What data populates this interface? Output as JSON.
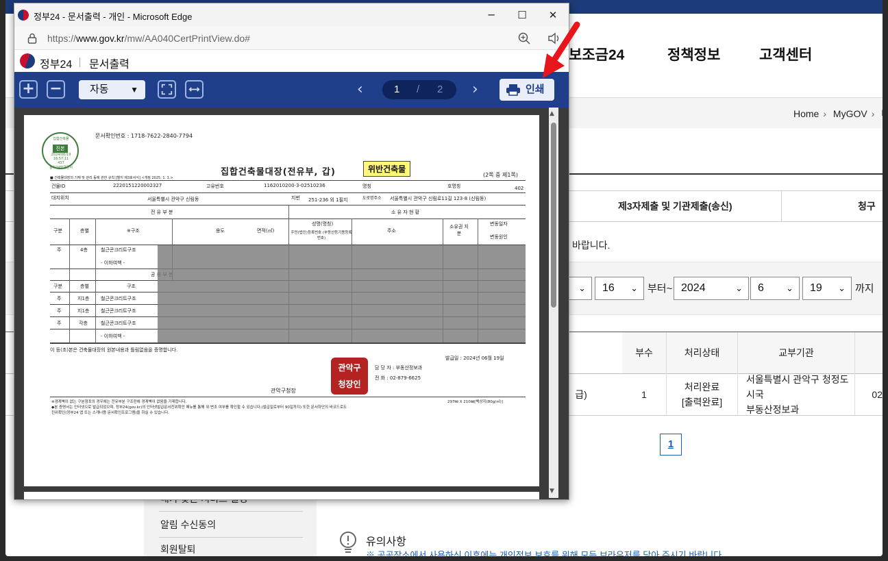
{
  "background_page": {
    "nav": [
      "보조금24",
      "정책정보",
      "고객센터"
    ],
    "breadcrumb": [
      "Home",
      "MyGOV",
      "나"
    ],
    "tabs": [
      "제3자제출 및 기관제출(송신)",
      "청구"
    ],
    "notice_fragment": "l 바랍니다.",
    "date_filter": {
      "start_day": "16",
      "from_label": "부터~",
      "end_year": "2024",
      "end_month": "6",
      "end_day": "19",
      "until_label": "까지"
    },
    "table": {
      "headers": [
        "부수",
        "처리상태",
        "교부기관"
      ],
      "row": {
        "first_cell_fragment": "급)",
        "copies": "1",
        "status_line1": "처리완료",
        "status_line2": "[출력완료]",
        "agency_line1": "서울특별시 관악구 청정도시국",
        "agency_line2": "부동산정보과",
        "last_cell_fragment": "02"
      }
    },
    "pagination": [
      "1"
    ],
    "sidebar": {
      "items": [
        "내가 찾은 서비스 설정",
        "알림 수신동의",
        "회원탈퇴"
      ]
    },
    "caution": {
      "title": "유의사항",
      "text": "※ 공공장소에서 사용하신 이후에는 개인정보 보호를 위해 모든 브라우저를 닫아 주시기 바랍니다."
    }
  },
  "popup": {
    "window_title": "정부24 - 문서출력 - 개인 - Microsoft Edge",
    "url_prefix": "https://",
    "url_host": "www.gov.kr",
    "url_path": "/mw/AA040CertPrintView.do#",
    "site_name": "정부24",
    "site_section": "문서출력",
    "viewer": {
      "zoom_mode": "자동",
      "current_page": "1",
      "page_separator": "/",
      "total_pages": "2",
      "print_label": "인쇄"
    },
    "document": {
      "doc_number": "문서확인번호 : 1718-7622-2840-7794",
      "title": "집합건축물대장(전유부, 갑)",
      "violation_badge": "위반건축물",
      "page_info": "(2쪽 중 제1쪽)",
      "seal_text": [
        "집합건축물",
        "진본",
        "2024/06/19",
        "16:57:11",
        "437",
        "정부24발급문서"
      ],
      "fine_print": "■ 건축물대장의 기재 및 관리 등에 관한 규칙 [별지 제3호서식] <개정 2025. 1. 1.>",
      "building_id_label": "건물ID",
      "building_id": "2220151220002327",
      "unique_no_label": "고유번호",
      "unique_no": "1162010200-3-02510236",
      "name_label": "명칭",
      "room_label": "호명칭",
      "room": "402",
      "site_label": "대지위치",
      "site_location": "서울특별시 관악구 신림동",
      "lot_label": "지번",
      "lot": "251-236 외 1필지",
      "road_label": "도로명주소",
      "road_address": "서울특별시 관악구 신림로11길 123-8 (신림동)",
      "section_exclusive": "전 유 부 분",
      "section_owner": "소 유 자 현 황",
      "col_headers": [
        "구분",
        "층별",
        "※구조",
        "용도",
        "면적(㎡)",
        "성명(명칭)",
        "주소",
        "소유권 지분",
        "변동일자"
      ],
      "owner_sub": "주민(법인)등록번호 (부동산등기용등록번호)",
      "change_cause": "변동원인",
      "excl_row": [
        "주",
        "4층",
        "철근콘크리트구조"
      ],
      "below_blank": "- 이하여백 -",
      "section_common": "공 용 부 분",
      "common_headers": [
        "구분",
        "층별",
        "구조"
      ],
      "common_rows": [
        [
          "주",
          "지1층",
          "철근콘크리트구조"
        ],
        [
          "주",
          "지1층",
          "철근콘크리트구조"
        ],
        [
          "주",
          "각층",
          "철근콘크리트구조"
        ]
      ],
      "certify_text": "이 등(초)본은 건축물대장의 원본내용과 틀림없음을 증명합니다.",
      "issue_date": "발급일 : 2024년 06월 19일",
      "officer": "담 당 자 : 부동산정보과",
      "phone": "전    화 : 02-879-6625",
      "issuer": "관악구청장",
      "red_seal": [
        "관악구",
        "청장인"
      ],
      "paper_size": "297㎜ X 210㎜[백상지(80g/㎡)]",
      "footnote1": "※경계벽이 없는 구분점포의 경우에는 전유부분 구조란에 경계벽이 없음을 기재합니다.",
      "footnote2": "◆본 증명서는 인터넷으로 발급되었으며, 정부24(gov.kr)의 인터넷발급문서진위확인 메뉴를 통해 위·변조 여부를 확인할 수 있습니다.(발급일로부터 90일까지) 또한 문서하단의 바코드로도",
      "footnote3": "진위확인(정부24 앱 또는 스캐너용 문서확인프로그램)을 하실 수 있습니다."
    }
  }
}
